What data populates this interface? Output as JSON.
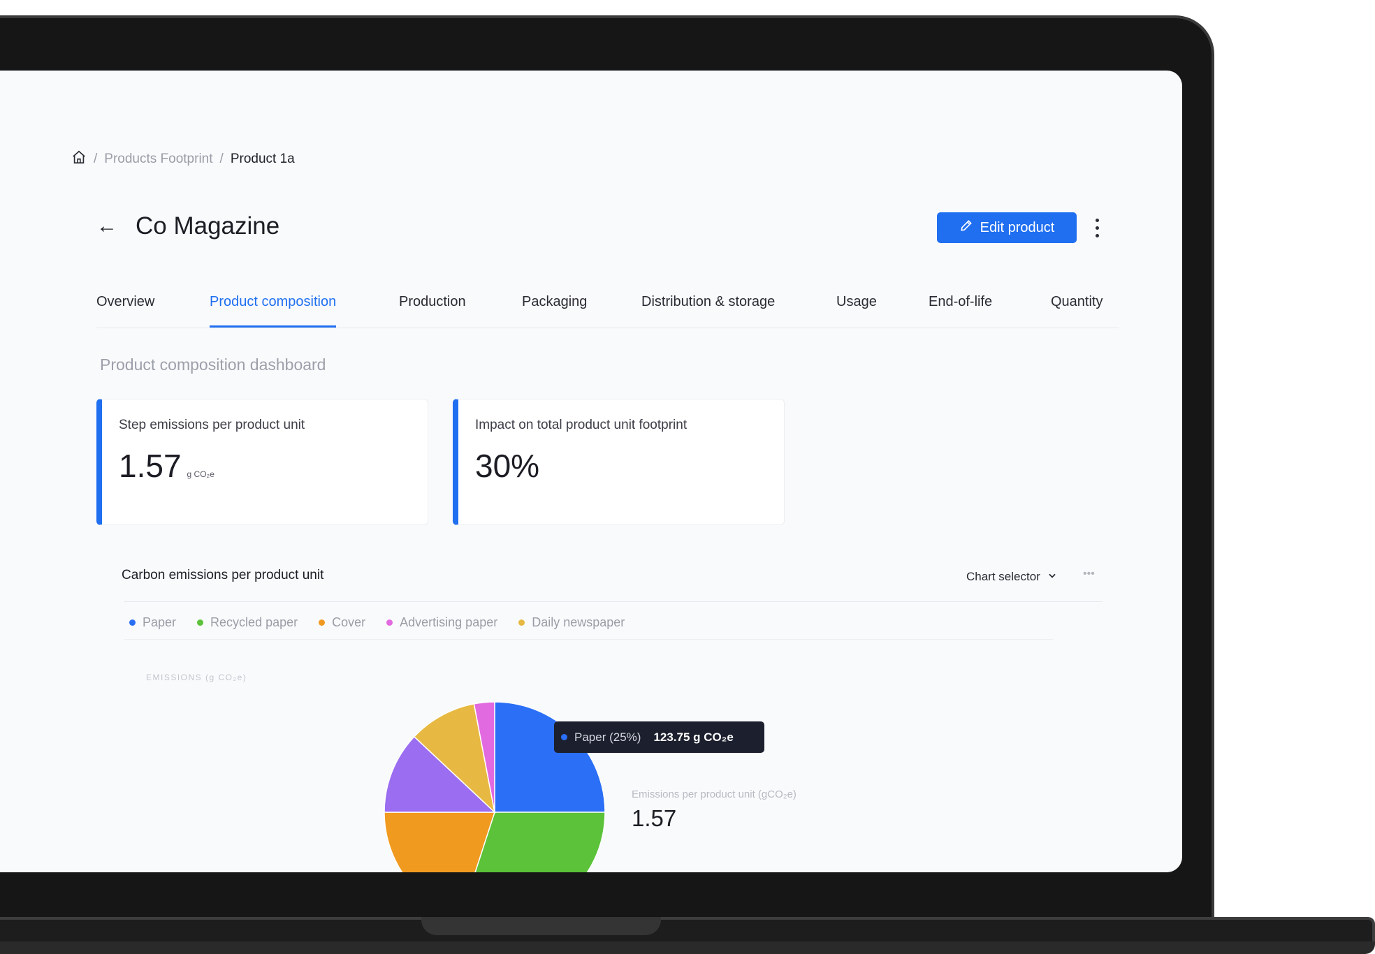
{
  "breadcrumb": {
    "home_icon": "home-icon",
    "items": [
      "Products Footprint",
      "Product 1a"
    ],
    "separator": "/"
  },
  "header": {
    "back_icon": "arrow-left-icon",
    "back_glyph": "←",
    "title": "Co Magazine",
    "edit_button": "Edit product",
    "edit_icon": "pencil-icon",
    "more_icon": "kebab-menu-icon"
  },
  "tabs": [
    {
      "label": "Overview",
      "active": false
    },
    {
      "label": "Product composition",
      "active": true
    },
    {
      "label": "Production",
      "active": false
    },
    {
      "label": "Packaging",
      "active": false
    },
    {
      "label": "Distribution & storage",
      "active": false
    },
    {
      "label": "Usage",
      "active": false
    },
    {
      "label": "End-of-life",
      "active": false
    },
    {
      "label": "Quantity",
      "active": false
    }
  ],
  "dashboard": {
    "section_label": "Product composition dashboard",
    "cards": [
      {
        "label": "Step emissions per product unit",
        "value": "1.57",
        "unit": "g CO₂e"
      },
      {
        "label": "Impact on total product unit footprint",
        "value": "30%",
        "unit": ""
      }
    ]
  },
  "chart_panel": {
    "title": "Carbon emissions per product unit",
    "selector_label": "Chart selector",
    "more_glyph": "•••",
    "axis_label": "EMISSIONS (g CO₂e)",
    "tooltip": {
      "label": "Paper (25%)",
      "value": "123.75 g CO₂e"
    },
    "summary_label": "Emissions per product unit (gCO₂e)",
    "summary_value": "1.57"
  },
  "colors": {
    "accent": "#1f6ff0",
    "paper": "#2a6ff5",
    "recycled_paper": "#5cc23a",
    "cover": "#f09a20",
    "advertising_paper": "#e26ae0",
    "daily_newspaper": "#e7b943",
    "other": "#9b6df0"
  },
  "chart_data": {
    "type": "pie",
    "legend": [
      "Paper",
      "Recycled paper",
      "Cover",
      "Advertising paper",
      "Daily newspaper"
    ],
    "slices": [
      {
        "name": "Paper",
        "percent": 25,
        "color": "#2a6ff5"
      },
      {
        "name": "Recycled paper",
        "percent": 30,
        "color": "#5cc23a"
      },
      {
        "name": "Cover",
        "percent": 20,
        "color": "#f09a20"
      },
      {
        "percent": 12,
        "color": "#9b6df0"
      },
      {
        "name": "Daily newspaper",
        "percent": 10,
        "color": "#e7b943"
      },
      {
        "name": "Advertising paper",
        "percent": 3,
        "color": "#e26ae0"
      }
    ],
    "highlighted": {
      "name": "Paper",
      "percent": 25,
      "value": 123.75,
      "unit": "g CO₂e"
    },
    "legend_placement": "top-left"
  }
}
